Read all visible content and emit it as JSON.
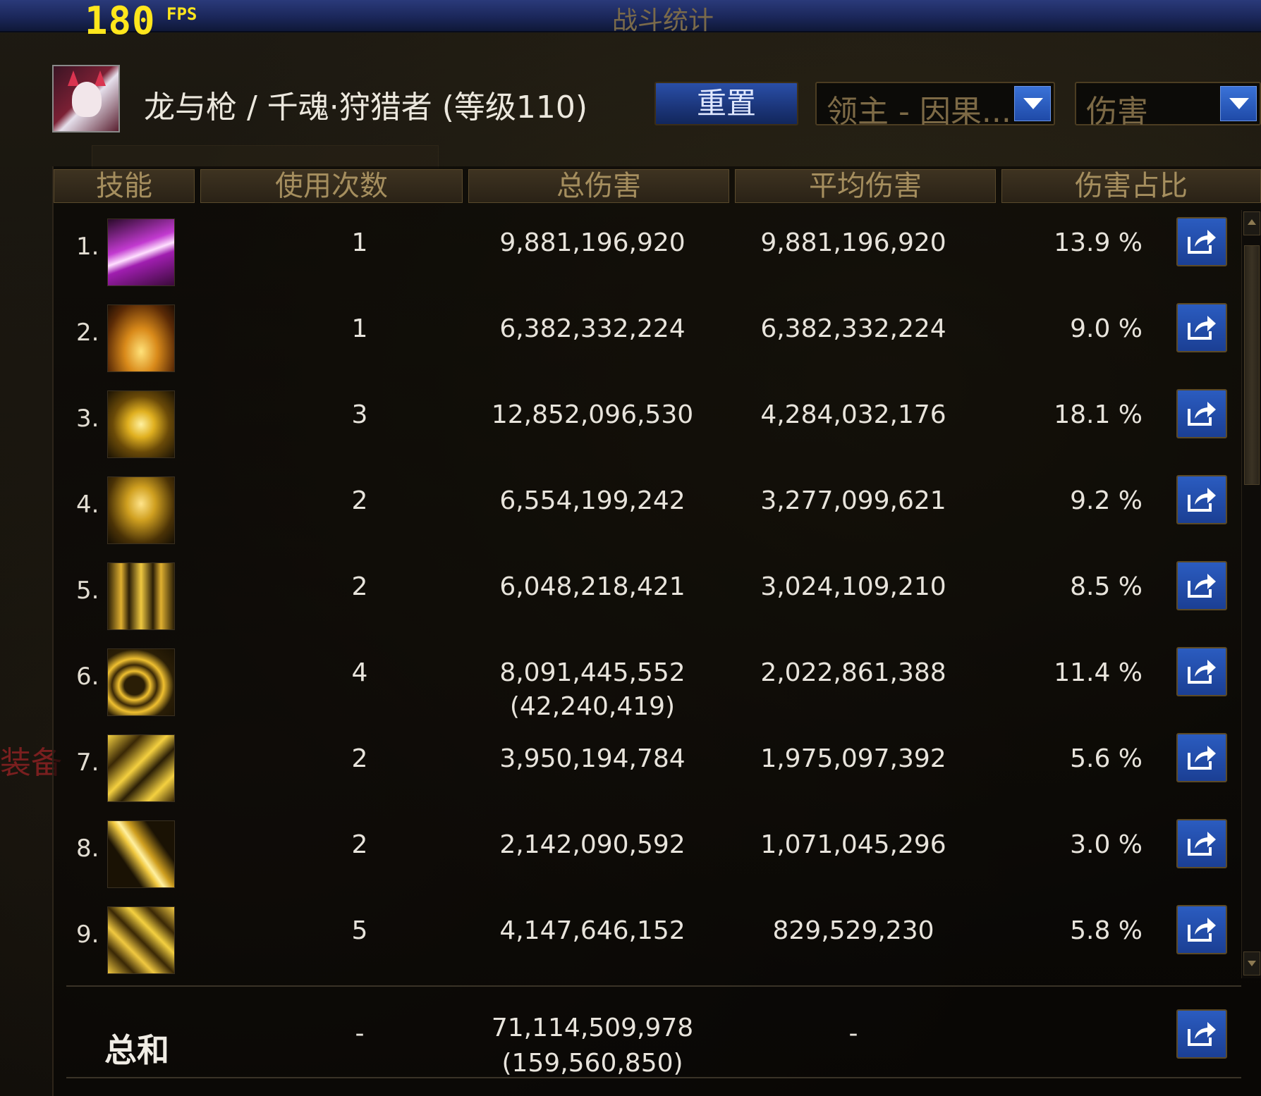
{
  "fps": {
    "value": "180",
    "unit": "FPS"
  },
  "window_title": "战斗统计",
  "character": {
    "name": "龙与枪 / 千魂·狩猎者 (等级110)"
  },
  "controls": {
    "reset_label": "重置",
    "dungeon_dropdown": "领主 - 因果...",
    "stat_dropdown": "伤害"
  },
  "table": {
    "headers": [
      "技能",
      "使用次数",
      "总伤害",
      "平均伤害",
      "伤害占比"
    ],
    "rows": [
      {
        "rank": "1.",
        "uses": "1",
        "total": "9,881,196,920",
        "avg": "9,881,196,920",
        "pct": "13.9 %"
      },
      {
        "rank": "2.",
        "uses": "1",
        "total": "6,382,332,224",
        "avg": "6,382,332,224",
        "pct": "9.0 %"
      },
      {
        "rank": "3.",
        "uses": "3",
        "total": "12,852,096,530",
        "avg": "4,284,032,176",
        "pct": "18.1 %"
      },
      {
        "rank": "4.",
        "uses": "2",
        "total": "6,554,199,242",
        "avg": "3,277,099,621",
        "pct": "9.2 %"
      },
      {
        "rank": "5.",
        "uses": "2",
        "total": "6,048,218,421",
        "avg": "3,024,109,210",
        "pct": "8.5 %"
      },
      {
        "rank": "6.",
        "uses": "4",
        "total": "8,091,445,552",
        "total_sub": "(42,240,419)",
        "avg": "2,022,861,388",
        "pct": "11.4 %"
      },
      {
        "rank": "7.",
        "uses": "2",
        "total": "3,950,194,784",
        "avg": "1,975,097,392",
        "pct": "5.6 %"
      },
      {
        "rank": "8.",
        "uses": "2",
        "total": "2,142,090,592",
        "avg": "1,071,045,296",
        "pct": "3.0 %"
      },
      {
        "rank": "9.",
        "uses": "5",
        "total": "4,147,646,152",
        "avg": "829,529,230",
        "pct": "5.8 %"
      }
    ],
    "total_row": {
      "label": "总和",
      "uses": "-",
      "total": "71,114,509,978",
      "total_sub": "(159,560,850)",
      "avg": "-"
    }
  },
  "background_text": {
    "left_edge": "装备"
  },
  "colors": {
    "fps": "#ffe61c",
    "title_bar": "#1b275a",
    "header_text": "#a58e5e",
    "button_blue": "#1b3f94"
  },
  "icons": [
    "share-icon",
    "dropdown-arrow-icon",
    "scroll-up-icon",
    "scroll-down-icon"
  ]
}
